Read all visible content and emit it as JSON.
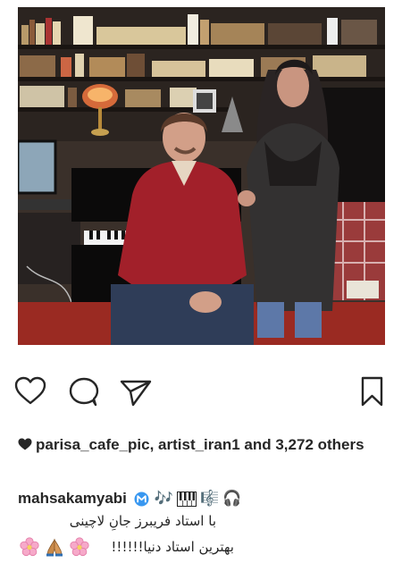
{
  "post": {
    "photo_alt": "",
    "actions": {
      "like_icon": "heart-outline-icon",
      "comment_icon": "comment-bubble-icon",
      "share_icon": "paper-plane-icon",
      "save_icon": "bookmark-icon"
    },
    "likes": {
      "text": "parisa_cafe_pic, artist_iran1 and 3,272 others"
    },
    "caption": {
      "username": "mahsakamyabi",
      "verified_icon": "verified-badge-icon",
      "emojis_line1": [
        "🎶",
        "🎹",
        "🎼",
        "🎧"
      ],
      "line2": "با استاد فریبرز جانِ لاچینی",
      "line3": "بهترین استاد دنیا!!!!!!",
      "emojis_line3": [
        "cherry-blossom",
        "folded-hands",
        "cherry-blossom"
      ]
    }
  },
  "colors": {
    "text": "#262626",
    "verified": "#3897f0",
    "flower": "#f6a9c9"
  }
}
